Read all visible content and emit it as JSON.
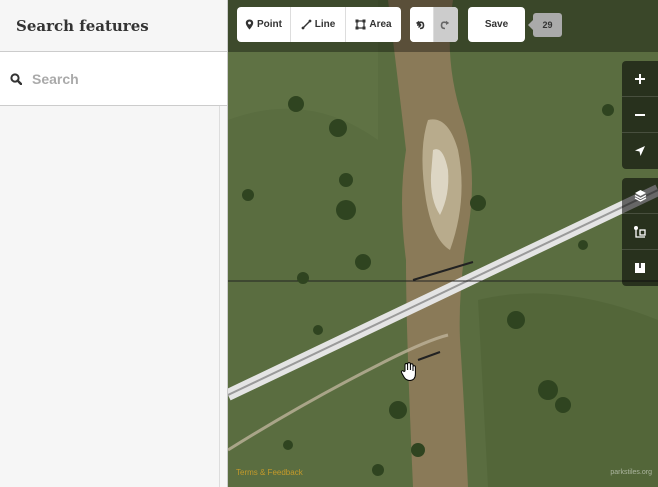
{
  "sidebar": {
    "title": "Search features",
    "search_placeholder": "Search"
  },
  "toolbar": {
    "point_label": "Point",
    "line_label": "Line",
    "area_label": "Area",
    "save_label": "Save",
    "edit_count": "29"
  },
  "map_controls": {
    "zoom_in": "zoom-in-icon",
    "zoom_out": "zoom-out-icon",
    "geolocate": "geolocate-icon",
    "layers": "layers-icon",
    "map_data": "map-data-icon",
    "help": "help-icon"
  },
  "footer": {
    "terms_label": "Terms & Feedback",
    "attribution": "parkstiles.org"
  },
  "colors": {
    "footer_link": "#c49a2a",
    "sidebar_bg": "#f6f6f6"
  }
}
